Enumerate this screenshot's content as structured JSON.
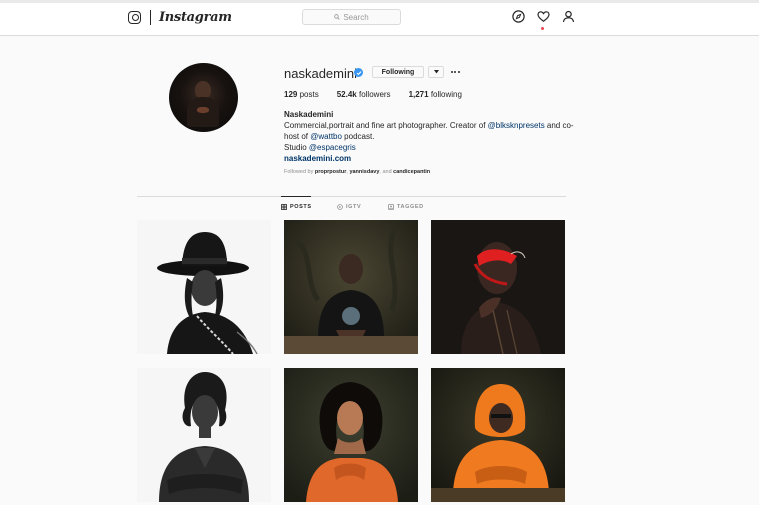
{
  "nav": {
    "wordmark": "Instagram",
    "search_placeholder": "Search",
    "icons": [
      "instagram-glyph-icon",
      "search-icon",
      "explore-icon",
      "heart-icon",
      "profile-icon"
    ],
    "notification_dot_color": "#ed4956"
  },
  "profile": {
    "username": "naskademini",
    "verified": true,
    "following_label": "Following",
    "stats": {
      "posts_count": "129",
      "posts_label": "posts",
      "followers_count": "52.4k",
      "followers_label": "followers",
      "following_count": "1,271",
      "following_label": "following"
    },
    "bio": {
      "name": "Naskademini",
      "line1_text": "Commercial,portrait and fine art photographer. Creator of ",
      "line1_mention": "@blksknpresets",
      "line1_tail": " and co-host of ",
      "line1_mention2": "@wattbo",
      "line1_end": " podcast.",
      "line2_text": "Studio ",
      "line2_mention": "@espacegris",
      "website": "naskademini.com"
    },
    "followed_by": {
      "prefix": "Followed by ",
      "user1": "proprpostur",
      "sep1": ", ",
      "user2": "yannisdavy",
      "sep2": ", and ",
      "user3": "candicepantin"
    }
  },
  "tabs": [
    {
      "label": "POSTS",
      "active": true
    },
    {
      "label": "IGTV",
      "active": false
    },
    {
      "label": "TAGGED",
      "active": false
    }
  ],
  "posts": [
    {
      "name": "post-woman-hat-bw"
    },
    {
      "name": "post-man-table-dark"
    },
    {
      "name": "post-man-red-light"
    },
    {
      "name": "post-woman-braids-bw"
    },
    {
      "name": "post-woman-orange-sweater"
    },
    {
      "name": "post-man-orange-hoodie"
    }
  ],
  "colors": {
    "link": "#003569",
    "verified": "#3897f0",
    "muted": "#8e8e8e",
    "border": "#dbdbdb"
  }
}
